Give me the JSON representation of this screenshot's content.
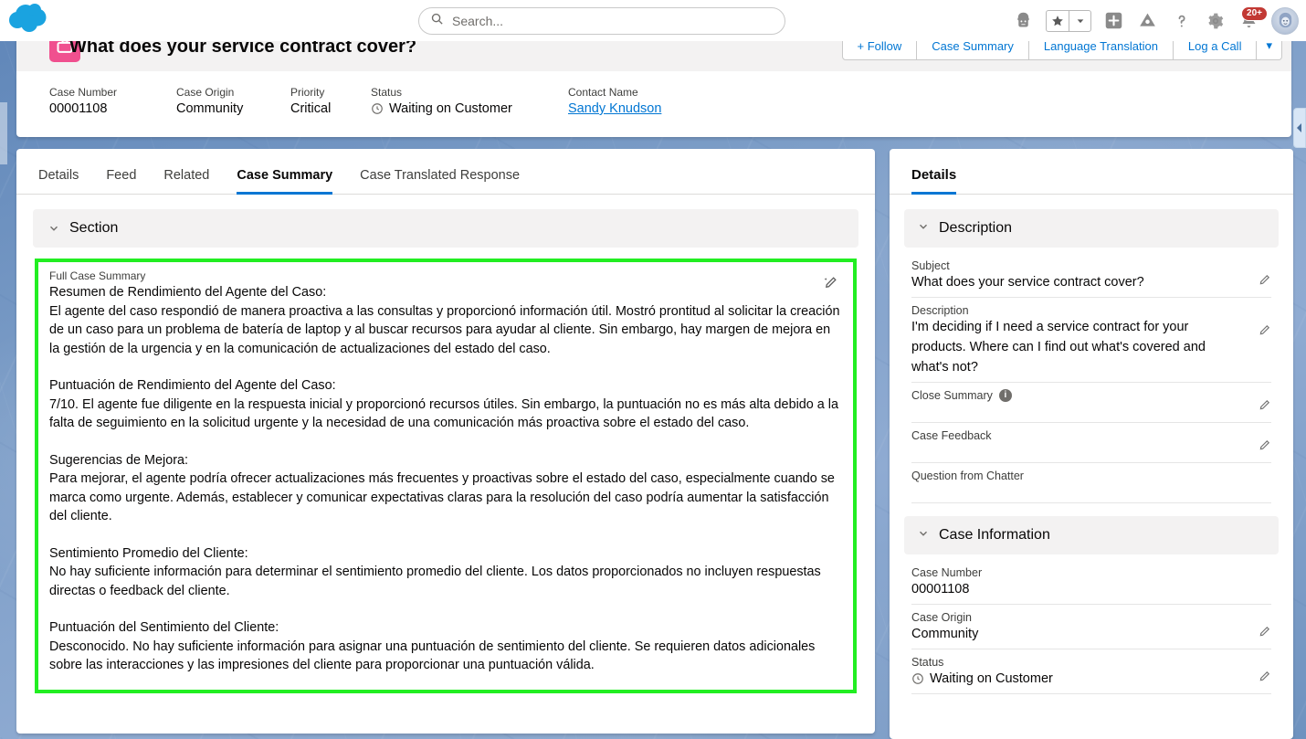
{
  "topbar": {
    "logo_name": "salesforce-cloud-logo",
    "search": {
      "placeholder": "Search...",
      "value": ""
    },
    "icons": [
      {
        "name": "guidance-center-icon",
        "glyph": "guidance"
      },
      {
        "name": "favorites-star-icon",
        "glyph": "star"
      },
      {
        "name": "favorites-dropdown-icon",
        "glyph": "caret"
      },
      {
        "name": "global-actions-icon",
        "glyph": "plus"
      },
      {
        "name": "app-launcher-icon",
        "glyph": "launcher"
      },
      {
        "name": "help-icon",
        "glyph": "question"
      },
      {
        "name": "setup-gear-icon",
        "glyph": "gear"
      },
      {
        "name": "notifications-bell-icon",
        "glyph": "bell"
      },
      {
        "name": "user-avatar",
        "glyph": "avatar"
      }
    ],
    "notification_count": "20+"
  },
  "record_header": {
    "object_icon": "case-icon",
    "title": "What does your service contract cover?",
    "actions": [
      {
        "label": "+ Follow",
        "name": "follow-button"
      },
      {
        "label": "Case Summary",
        "name": "case-summary-button"
      },
      {
        "label": "Language Translation",
        "name": "language-translation-button"
      },
      {
        "label": "Log a Call",
        "name": "log-a-call-button"
      },
      {
        "label": "▾",
        "name": "more-actions-button"
      }
    ],
    "fields": [
      {
        "label": "Case Number",
        "value": "00001108"
      },
      {
        "label": "Case Origin",
        "value": "Community"
      },
      {
        "label": "Priority",
        "value": "Critical"
      },
      {
        "label": "Status",
        "value": "Waiting on Customer"
      },
      {
        "label": "Contact Name",
        "value": "Sandy Knudson"
      }
    ]
  },
  "main": {
    "tabs": [
      {
        "label": "Details",
        "active": false
      },
      {
        "label": "Feed",
        "active": false
      },
      {
        "label": "Related",
        "active": false
      },
      {
        "label": "Case Summary",
        "active": true
      },
      {
        "label": "Case Translated Response",
        "active": false
      }
    ],
    "section_title": "Section",
    "summary": {
      "field_label": "Full Case Summary",
      "edit_icon": "ai-edit-pencil-icon",
      "paragraphs": [
        "Resumen de Rendimiento del Agente del Caso:",
        "El agente del caso respondió de manera proactiva a las consultas y proporcionó información útil. Mostró prontitud al solicitar la creación de un caso para un problema de batería de laptop y al buscar recursos para ayudar al cliente. Sin embargo, hay margen de mejora en la gestión de la urgencia y en la comunicación de actualizaciones del estado del caso.",
        "Puntuación de Rendimiento del Agente del Caso:",
        "7/10. El agente fue diligente en la respuesta inicial y proporcionó recursos útiles. Sin embargo, la puntuación no es más alta debido a la falta de seguimiento en la solicitud urgente y la necesidad de una comunicación más proactiva sobre el estado del caso.",
        "Sugerencias de Mejora:",
        "Para mejorar, el agente podría ofrecer actualizaciones más frecuentes y proactivas sobre el estado del caso, especialmente cuando se marca como urgente. Además, establecer y comunicar expectativas claras para la resolución del caso podría aumentar la satisfacción del cliente.",
        "Sentimiento Promedio del Cliente:",
        "No hay suficiente información para determinar el sentimiento promedio del cliente. Los datos proporcionados no incluyen respuestas directas o feedback del cliente.",
        "Puntuación del Sentimiento del Cliente:",
        "Desconocido. No hay suficiente información para asignar una puntuación de sentimiento del cliente. Se requieren datos adicionales sobre las interacciones y las impresiones del cliente para proporcionar una puntuación válida."
      ]
    }
  },
  "right_panel": {
    "tab_label": "Details",
    "sections": [
      {
        "title": "Description",
        "name": "description-section",
        "fields": [
          {
            "label": "Subject",
            "value": "What does your service contract cover?",
            "editable": true,
            "info": false
          },
          {
            "label": "Description",
            "value": "I'm deciding if I need a service contract for your products. Where can I find out what's covered and what's not?",
            "editable": true,
            "info": false
          },
          {
            "label": "Close Summary",
            "value": "",
            "editable": true,
            "info": true
          },
          {
            "label": "Case Feedback",
            "value": "",
            "editable": true,
            "info": false
          },
          {
            "label": "Question from Chatter",
            "value": "",
            "editable": false,
            "info": false
          }
        ]
      },
      {
        "title": "Case Information",
        "name": "case-information-section",
        "fields": [
          {
            "label": "Case Number",
            "value": "00001108",
            "editable": false,
            "info": false
          },
          {
            "label": "Case Origin",
            "value": "Community",
            "editable": true,
            "info": false
          },
          {
            "label": "Status",
            "value": "Waiting on Customer",
            "editable": true,
            "info": false,
            "status_icon": true
          }
        ]
      }
    ]
  },
  "colors": {
    "accent_blue": "#0176d3",
    "highlight_green": "#22ee22",
    "case_icon_pink": "#f0508f",
    "notification_red": "#c23934",
    "background_blue": "#7c9dc7"
  }
}
